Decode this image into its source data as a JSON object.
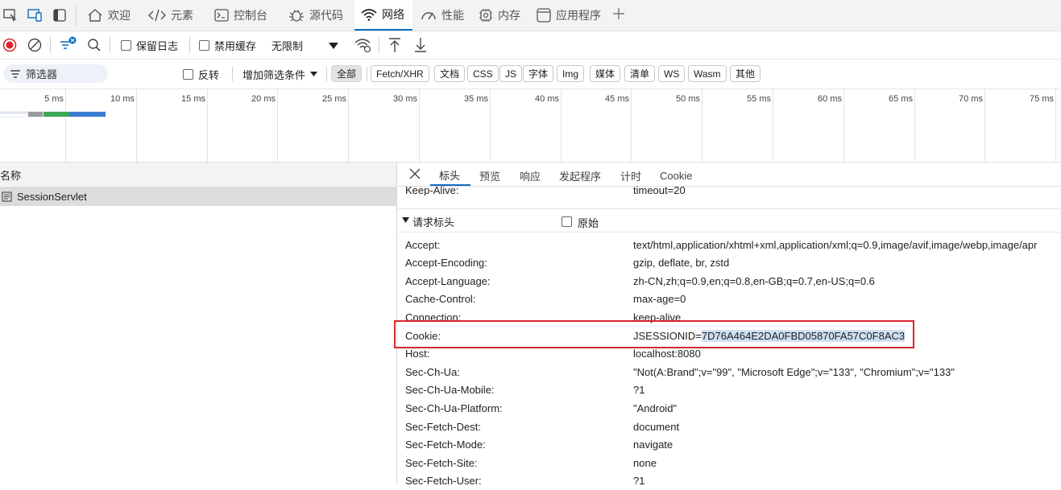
{
  "tabs": [
    {
      "label": "欢迎",
      "icon": "home-icon"
    },
    {
      "label": "元素",
      "icon": "code-icon"
    },
    {
      "label": "控制台",
      "icon": "console-icon"
    },
    {
      "label": "源代码",
      "icon": "bug-icon"
    },
    {
      "label": "网络",
      "icon": "wifi-icon",
      "active": true
    },
    {
      "label": "性能",
      "icon": "performance-icon"
    },
    {
      "label": "内存",
      "icon": "memory-icon"
    },
    {
      "label": "应用程序",
      "icon": "app-icon"
    }
  ],
  "toolbar": {
    "preserve_log": "保留日志",
    "disable_cache": "禁用缓存",
    "throttling": "无限制"
  },
  "filterbar": {
    "filter_placeholder": "筛选器",
    "invert": "反转",
    "more_filters": "增加筛选条件",
    "chips": [
      "全部",
      "Fetch/XHR",
      "文档",
      "CSS",
      "JS",
      "字体",
      "Img",
      "媒体",
      "清单",
      "WS",
      "Wasm",
      "其他"
    ]
  },
  "timeline": {
    "ticks": [
      "5 ms",
      "10 ms",
      "15 ms",
      "20 ms",
      "25 ms",
      "30 ms",
      "35 ms",
      "40 ms",
      "45 ms",
      "50 ms",
      "55 ms",
      "60 ms",
      "65 ms",
      "70 ms",
      "75 ms"
    ]
  },
  "requests": {
    "column_header": "名称",
    "items": [
      {
        "name": "SessionServlet"
      }
    ]
  },
  "detail": {
    "tabs": [
      "标头",
      "预览",
      "响应",
      "发起程序",
      "计时",
      "Cookie"
    ],
    "partial_row": {
      "name": "Keep-Alive:",
      "value": "timeout=20"
    },
    "section_title": "请求标头",
    "raw_label": "原始",
    "headers": [
      {
        "name": "Accept:",
        "value": "text/html,application/xhtml+xml,application/xml;q=0.9,image/avif,image/webp,image/apr"
      },
      {
        "name": "Accept-Encoding:",
        "value": "gzip, deflate, br, zstd"
      },
      {
        "name": "Accept-Language:",
        "value": "zh-CN,zh;q=0.9,en;q=0.8,en-GB;q=0.7,en-US;q=0.6"
      },
      {
        "name": "Cache-Control:",
        "value": "max-age=0"
      },
      {
        "name": "Connection:",
        "value": "keep-alive"
      },
      {
        "name": "Cookie:",
        "value": "JSESSIONID=7D76A464E2DA0FBD05870FA57C0F8AC3"
      },
      {
        "name": "Host:",
        "value": "localhost:8080"
      },
      {
        "name": "Sec-Ch-Ua:",
        "value": "\"Not(A:Brand\";v=\"99\", \"Microsoft Edge\";v=\"133\", \"Chromium\";v=\"133\""
      },
      {
        "name": "Sec-Ch-Ua-Mobile:",
        "value": "?1"
      },
      {
        "name": "Sec-Ch-Ua-Platform:",
        "value": "\"Android\""
      },
      {
        "name": "Sec-Fetch-Dest:",
        "value": "document"
      },
      {
        "name": "Sec-Fetch-Mode:",
        "value": "navigate"
      },
      {
        "name": "Sec-Fetch-Site:",
        "value": "none"
      },
      {
        "name": "Sec-Fetch-User:",
        "value": "?1"
      }
    ],
    "cookie_prefix": "JSESSIONID=",
    "cookie_selected": "7D76A464E2DA0FBD05870FA57C0F8AC3"
  },
  "colors": {
    "accent": "#0f6cbd",
    "record": "#d9262c",
    "highlight_border": "#d9262c",
    "selection": "#cfe0f3"
  }
}
